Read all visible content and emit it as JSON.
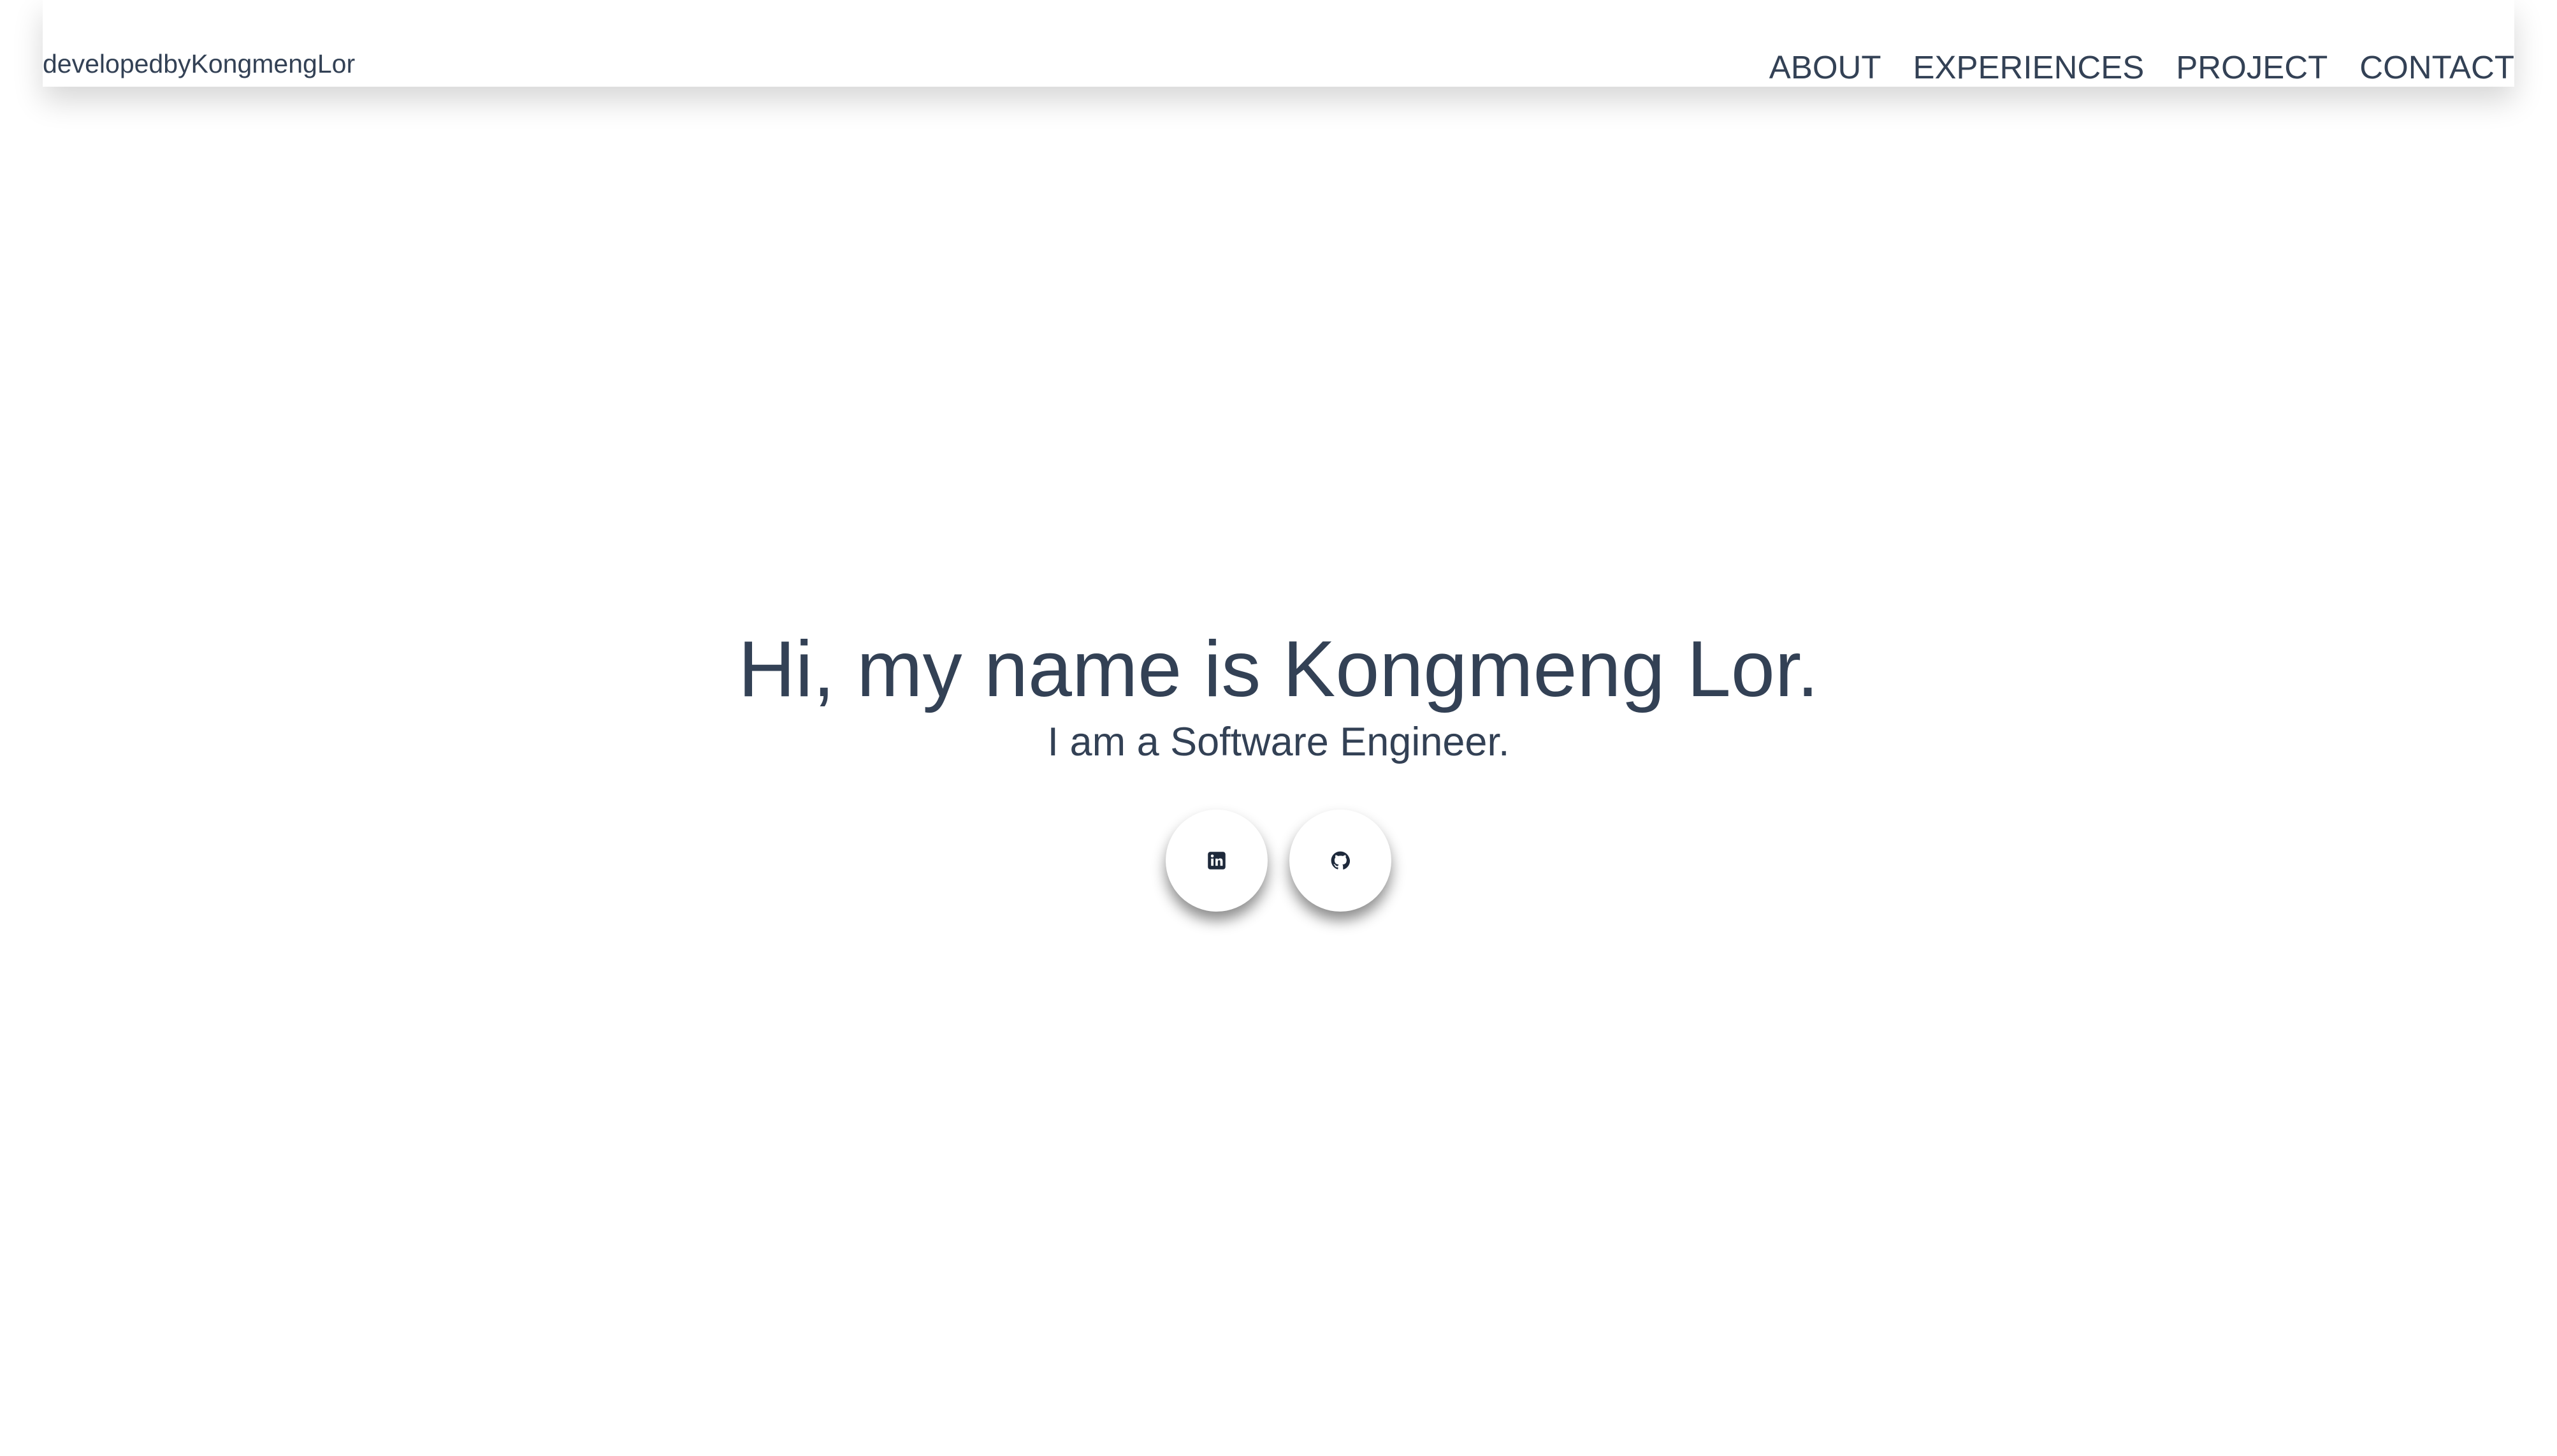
{
  "header": {
    "brand": "developedbyKongmengLor",
    "nav": [
      {
        "label": "ABOUT"
      },
      {
        "label": "EXPERIENCES"
      },
      {
        "label": "PROJECT"
      },
      {
        "label": "CONTACT"
      }
    ]
  },
  "hero": {
    "title": "Hi, my name is Kongmeng Lor.",
    "subtitle": "I am a Software Engineer."
  },
  "social": [
    {
      "icon": "linkedin-icon"
    },
    {
      "icon": "github-icon"
    }
  ],
  "colors": {
    "text": "#334155",
    "background": "#ffffff"
  }
}
